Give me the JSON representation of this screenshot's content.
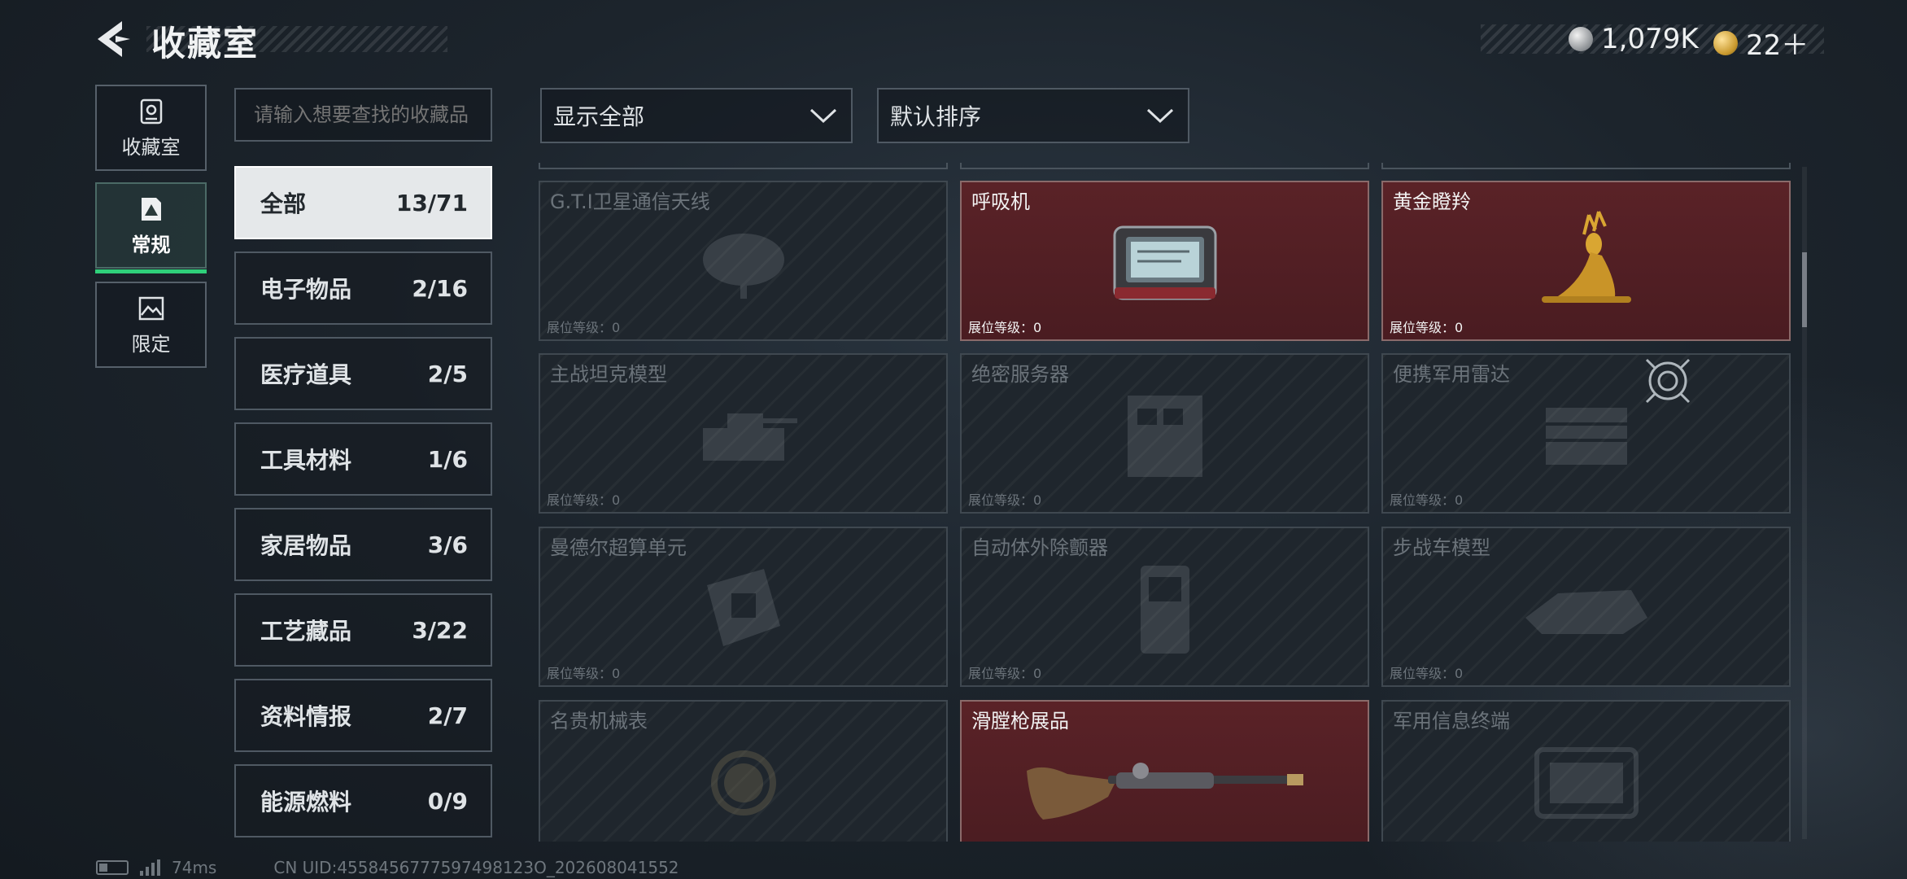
{
  "header": {
    "title": "收藏室",
    "currency_silver": "1,079K",
    "currency_gold": "22＋"
  },
  "side_nav": [
    {
      "label": "收藏室",
      "icon": "vault-icon"
    },
    {
      "label": "常规",
      "icon": "document-icon"
    },
    {
      "label": "限定",
      "icon": "image-icon"
    }
  ],
  "search": {
    "placeholder": "请输入想要查找的收藏品"
  },
  "categories": [
    {
      "name": "全部",
      "count": "13/71"
    },
    {
      "name": "电子物品",
      "count": "2/16"
    },
    {
      "name": "医疗道具",
      "count": "2/5"
    },
    {
      "name": "工具材料",
      "count": "1/6"
    },
    {
      "name": "家居物品",
      "count": "3/6"
    },
    {
      "name": "工艺藏品",
      "count": "3/22"
    },
    {
      "name": "资料情报",
      "count": "2/7"
    },
    {
      "name": "能源燃料",
      "count": "0/9"
    }
  ],
  "filters": {
    "display": "显示全部",
    "sort": "默认排序"
  },
  "level_label": "展位等级：0",
  "items": [
    {
      "name": "G.T.I卫星通信天线",
      "owned": false,
      "icon": "satellite-dish-icon"
    },
    {
      "name": "呼吸机",
      "owned": true,
      "icon": "ventilator-icon"
    },
    {
      "name": "黄金瞪羚",
      "owned": true,
      "icon": "golden-gazelle-icon"
    },
    {
      "name": "主战坦克模型",
      "owned": false,
      "icon": "tank-model-icon"
    },
    {
      "name": "绝密服务器",
      "owned": false,
      "icon": "server-icon"
    },
    {
      "name": "便携军用雷达",
      "owned": false,
      "icon": "radar-icon"
    },
    {
      "name": "曼德尔超算单元",
      "owned": false,
      "icon": "supercomputer-unit-icon"
    },
    {
      "name": "自动体外除颤器",
      "owned": false,
      "icon": "defibrillator-icon"
    },
    {
      "name": "步战车模型",
      "owned": false,
      "icon": "ifv-model-icon"
    },
    {
      "name": "名贵机械表",
      "owned": false,
      "icon": "watch-icon"
    },
    {
      "name": "滑膛枪展品",
      "owned": true,
      "icon": "musket-icon"
    },
    {
      "name": "军用信息终端",
      "owned": false,
      "icon": "terminal-icon"
    }
  ],
  "footer": {
    "ping": "74ms",
    "uid": "CN UID:4558456777597498123O_202608041552"
  }
}
